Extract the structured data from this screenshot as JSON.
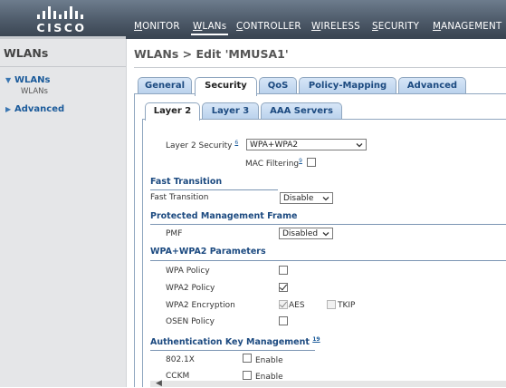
{
  "brand": {
    "logo_text": "CISCO"
  },
  "topnav": [
    {
      "label": "MONITOR"
    },
    {
      "label": "WLANs"
    },
    {
      "label": "CONTROLLER"
    },
    {
      "label": "WIRELESS"
    },
    {
      "label": "SECURITY"
    },
    {
      "label": "MANAGEMENT"
    }
  ],
  "sidebar": {
    "title": "WLANs",
    "items": [
      {
        "label": "WLANs",
        "sub": "WLANs"
      },
      {
        "label": "Advanced"
      }
    ]
  },
  "page": {
    "title": "WLANs > Edit  'MMUSA1'"
  },
  "tabs": [
    {
      "label": "General"
    },
    {
      "label": "Security"
    },
    {
      "label": "QoS"
    },
    {
      "label": "Policy-Mapping"
    },
    {
      "label": "Advanced"
    }
  ],
  "subtabs": [
    {
      "label": "Layer 2"
    },
    {
      "label": "Layer 3"
    },
    {
      "label": "AAA Servers"
    }
  ],
  "form": {
    "layer2_security_label": "Layer 2 Security",
    "layer2_security_note": "6",
    "layer2_security_value": "WPA+WPA2",
    "mac_filtering_label": "MAC Filtering",
    "mac_filtering_note": "9",
    "fast_transition_section": "Fast Transition",
    "fast_transition_label": "Fast Transition",
    "fast_transition_value": "Disable",
    "pmf_section": "Protected Management Frame",
    "pmf_label": "PMF",
    "pmf_value": "Disabled",
    "wpa_section": "WPA+WPA2 Parameters",
    "wpa_policy_label": "WPA Policy",
    "wpa2_policy_label": "WPA2 Policy",
    "wpa2_encryption_label": "WPA2 Encryption",
    "aes_label": "AES",
    "tkip_label": "TKIP",
    "osen_policy_label": "OSEN Policy",
    "akm_section": "Authentication Key Management",
    "akm_note": "19",
    "dot1x_label": "802.1X",
    "cckm_label": "CCKM",
    "enable_label": "Enable"
  }
}
